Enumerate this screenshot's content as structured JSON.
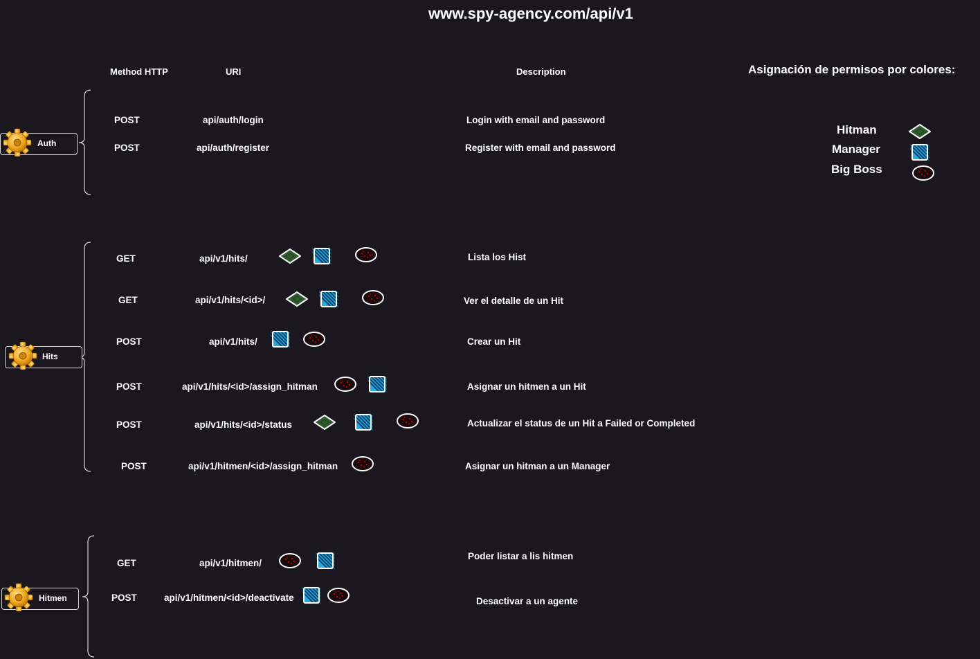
{
  "title": "www.spy-agency.com/api/v1",
  "headers": {
    "method": "Method HTTP",
    "uri": "URI",
    "description": "Description"
  },
  "legend": {
    "title": "Asignación de permisos por colores:",
    "items": [
      {
        "label": "Hitman",
        "icon": "diamond-icon"
      },
      {
        "label": "Manager",
        "icon": "striped-square-icon"
      },
      {
        "label": "Big Boss",
        "icon": "circle-dots-icon"
      }
    ]
  },
  "groups": [
    {
      "name": "Auth",
      "endpoints": [
        {
          "method": "POST",
          "uri": "api/auth/login",
          "description": "Login with email and password",
          "permissions": []
        },
        {
          "method": "POST",
          "uri": "api/auth/register",
          "description": "Register with email and password",
          "permissions": []
        }
      ]
    },
    {
      "name": "Hits",
      "endpoints": [
        {
          "method": "GET",
          "uri": "api/v1/hits/",
          "description": "Lista los Hist",
          "permissions": [
            "Hitman",
            "Manager",
            "Big Boss"
          ]
        },
        {
          "method": "GET",
          "uri": "api/v1/hits/<id>/",
          "description": "Ver el detalle de un Hit",
          "permissions": [
            "Hitman",
            "Manager",
            "Big Boss"
          ]
        },
        {
          "method": "POST",
          "uri": "api/v1/hits/",
          "description": "Crear un Hit",
          "permissions": [
            "Manager",
            "Big Boss"
          ]
        },
        {
          "method": "POST",
          "uri": "api/v1/hits/<id>/assign_hitman",
          "description": "Asignar un hitmen a un Hit",
          "permissions": [
            "Big Boss",
            "Manager"
          ]
        },
        {
          "method": "POST",
          "uri": "api/v1/hits/<id>/status",
          "description": "Actualizar el status de un Hit a Failed or Completed",
          "permissions": [
            "Hitman",
            "Manager",
            "Big Boss"
          ]
        },
        {
          "method": "POST",
          "uri": "api/v1/hitmen/<id>/assign_hitman",
          "description": "Asignar un hitman a un Manager",
          "permissions": [
            "Big Boss"
          ]
        }
      ]
    },
    {
      "name": "Hitmen",
      "endpoints": [
        {
          "method": "GET",
          "uri": "api/v1/hitmen/",
          "description": "Poder listar a lis hitmen",
          "permissions": [
            "Big Boss",
            "Manager"
          ]
        },
        {
          "method": "POST",
          "uri": "api/v1/hitmen/<id>/deactivate",
          "description": "Desactivar a un agente",
          "permissions": [
            "Manager",
            "Big Boss"
          ]
        }
      ]
    }
  ],
  "colors": {
    "background": "#1a171e",
    "hitman": "#2e5a2e",
    "manager": "#29a9e1",
    "big_boss": "#c00000",
    "stroke": "#ffffff"
  }
}
